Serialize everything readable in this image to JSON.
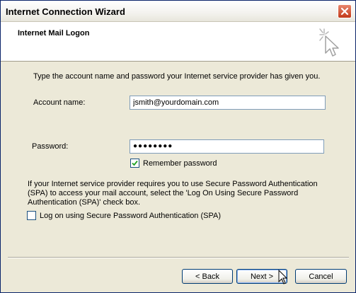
{
  "window": {
    "title": "Internet Connection Wizard"
  },
  "header": {
    "title": "Internet Mail Logon",
    "icon": "wizard-sparkle-cursor-icon"
  },
  "form": {
    "intro": "Type the account name and password your Internet service provider has given you.",
    "account_label": "Account name:",
    "account_value": "jsmith@yourdomain.com",
    "password_label": "Password:",
    "password_value": "●●●●●●●●",
    "remember_label": "Remember password",
    "remember_checked": true,
    "spa_description": "If your Internet service provider requires you to use Secure Password Authentication (SPA) to access your mail account, select the 'Log On Using Secure Password Authentication (SPA)' check box.",
    "spa_label": "Log on using Secure Password Authentication (SPA)",
    "spa_checked": false
  },
  "buttons": {
    "back": "< Back",
    "next": "Next >",
    "cancel": "Cancel"
  },
  "colors": {
    "close_button": "#c23a1a",
    "dialog_background": "#ece9d8",
    "checkmark": "#21a121"
  }
}
